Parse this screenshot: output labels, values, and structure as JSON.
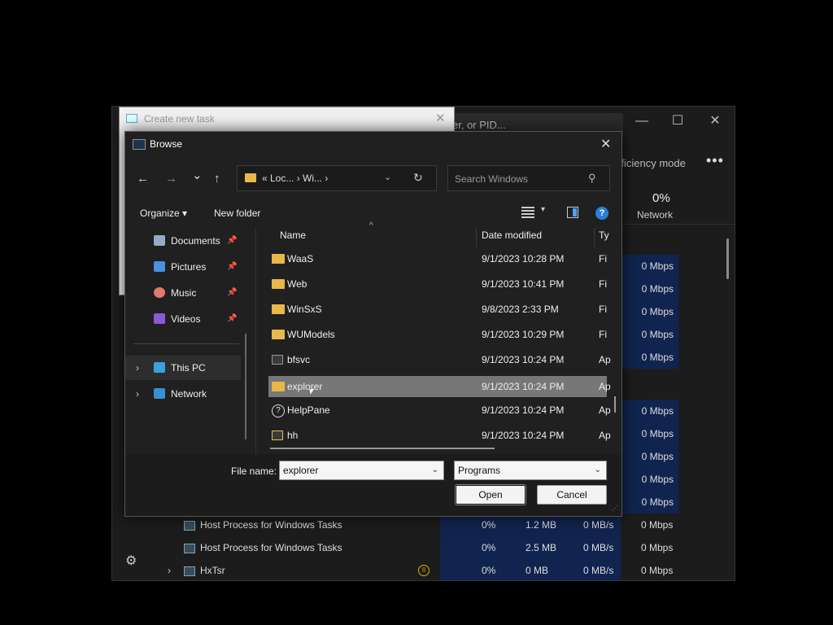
{
  "task_manager": {
    "search_text": "er, or PID...",
    "efficiency_mode": "fficiency mode",
    "more": "•••",
    "network_pct": "0%",
    "network_label": "Network",
    "controls": {
      "minimize": "—",
      "maximize": "☐",
      "close": "✕"
    },
    "net_cells": [
      "0 Mbps",
      "0 Mbps",
      "0 Mbps",
      "0 Mbps",
      "0 Mbps",
      "0 Mbps",
      "0 Mbps",
      "0 Mbps",
      "0 Mbps",
      "0 Mbps"
    ],
    "rows": [
      {
        "name": "Host Process for Windows Tasks",
        "cpu": "0%",
        "mem": "1.2 MB",
        "disk": "0 MB/s",
        "net": "0 Mbps"
      },
      {
        "name": "Host Process for Windows Tasks",
        "cpu": "0%",
        "mem": "2.5 MB",
        "disk": "0 MB/s",
        "net": "0 Mbps"
      },
      {
        "name": "HxTsr",
        "cpu": "0%",
        "mem": "0 MB",
        "disk": "0 MB/s",
        "net": "0 Mbps"
      }
    ]
  },
  "create_task": {
    "title": "Create new task",
    "close": "✕"
  },
  "browse": {
    "title": "Browse",
    "close": "✕",
    "nav": {
      "back": "←",
      "forward": "→",
      "recent": "⌄",
      "up": "↑"
    },
    "address_crumbs": "« Loc...  ›  Wi...  ›",
    "search_placeholder": "Search Windows",
    "organize": "Organize ▾",
    "new_folder": "New folder",
    "help": "?",
    "nav_items": [
      {
        "label": "Documents",
        "color": "#9aa8c8"
      },
      {
        "label": "Pictures",
        "color": "#4a8fe0"
      },
      {
        "label": "Music",
        "color": "#e07a6a"
      },
      {
        "label": "Videos",
        "color": "#8a5ad0"
      },
      {
        "label": "This PC",
        "color": "#3aa0e0"
      },
      {
        "label": "Network",
        "color": "#3a8fd0"
      }
    ],
    "columns": {
      "name": "Name",
      "date": "Date modified",
      "type": "Ty"
    },
    "files": [
      {
        "name": "WaaS",
        "date": "9/1/2023 10:28 PM",
        "type": "Fi",
        "kind": "folder"
      },
      {
        "name": "Web",
        "date": "9/1/2023 10:41 PM",
        "type": "Fi",
        "kind": "folder"
      },
      {
        "name": "WinSxS",
        "date": "9/8/2023 2:33 PM",
        "type": "Fi",
        "kind": "folder"
      },
      {
        "name": "WUModels",
        "date": "9/1/2023 10:29 PM",
        "type": "Fi",
        "kind": "folder"
      },
      {
        "name": "bfsvc",
        "date": "9/1/2023 10:24 PM",
        "type": "Aр",
        "kind": "app"
      },
      {
        "name": "explorer",
        "date": "9/1/2023 10:24 PM",
        "type": "Aр",
        "kind": "folder"
      },
      {
        "name": "HelpPane",
        "date": "9/1/2023 10:24 PM",
        "type": "Aр",
        "kind": "help"
      },
      {
        "name": "hh",
        "date": "9/1/2023 10:24 PM",
        "type": "Aр",
        "kind": "app"
      }
    ],
    "file_name_label": "File name:",
    "file_name_value": "explorer",
    "file_type_value": "Programs",
    "open": "Open",
    "cancel": "Cancel"
  }
}
